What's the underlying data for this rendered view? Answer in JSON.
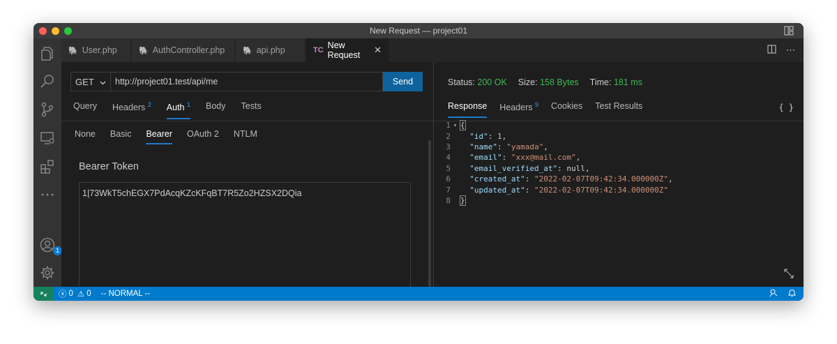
{
  "window": {
    "title": "New Request — project01"
  },
  "tabs": [
    {
      "label": "User.php",
      "icon": "php-elephant-icon"
    },
    {
      "label": "AuthController.php",
      "icon": "php-elephant-icon"
    },
    {
      "label": "api.php",
      "icon": "php-elephant-icon"
    },
    {
      "label": "New Request",
      "icon": "tc-icon",
      "icon_text": "TC",
      "active": true
    }
  ],
  "request": {
    "method": "GET",
    "url": "http://project01.test/api/me",
    "send_label": "Send",
    "tabs": [
      {
        "label": "Query",
        "badge": ""
      },
      {
        "label": "Headers",
        "badge": "2"
      },
      {
        "label": "Auth",
        "badge": "1",
        "active": true
      },
      {
        "label": "Body",
        "badge": ""
      },
      {
        "label": "Tests",
        "badge": ""
      }
    ],
    "auth_tabs": [
      "None",
      "Basic",
      "Bearer",
      "OAuth 2",
      "NTLM"
    ],
    "auth_active": "Bearer",
    "bearer_label": "Bearer Token",
    "token": "1|73WkT5chEGX7PdAcqKZcKFqBT7R5Zo2HZSX2DQia"
  },
  "response": {
    "status_label": "Status:",
    "status_value": "200 OK",
    "size_label": "Size:",
    "size_value": "158 Bytes",
    "time_label": "Time:",
    "time_value": "181 ms",
    "tabs": [
      {
        "label": "Response",
        "badge": "",
        "active": true
      },
      {
        "label": "Headers",
        "badge": "9"
      },
      {
        "label": "Cookies",
        "badge": ""
      },
      {
        "label": "Test Results",
        "badge": ""
      }
    ],
    "braces": "{ }",
    "lines": [
      "1",
      "2",
      "3",
      "4",
      "5",
      "6",
      "7",
      "8"
    ],
    "json": {
      "id_key": "\"id\"",
      "id_val": "1",
      "name_key": "\"name\"",
      "name_val": "\"yamada\"",
      "email_key": "\"email\"",
      "email_val": "\"xxx@mail.com\"",
      "ev_key": "\"email_verified_at\"",
      "ev_val": "null",
      "created_key": "\"created_at\"",
      "created_val": "\"2022-02-07T09:42:34.000000Z\"",
      "updated_key": "\"updated_at\"",
      "updated_val": "\"2022-02-07T09:42:34.000000Z\""
    }
  },
  "statusbar": {
    "errors": "0",
    "warnings": "0",
    "mode": "-- NORMAL --"
  },
  "activity": {
    "accounts_badge": "1"
  },
  "colors": {
    "accent": "#007acc",
    "send": "#0e639c",
    "ok": "#3fb950"
  }
}
